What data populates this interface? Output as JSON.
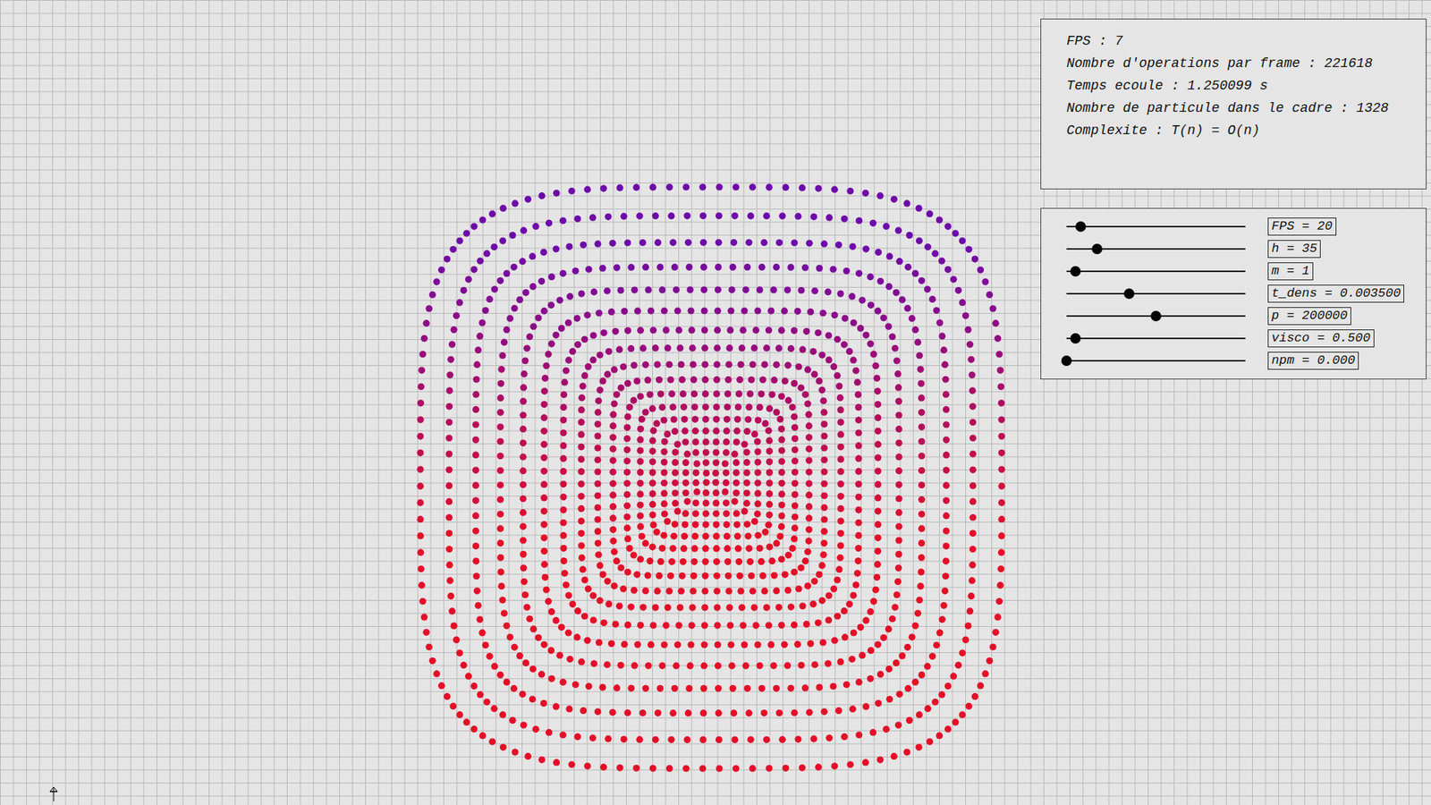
{
  "info": {
    "lines": [
      "FPS : 7",
      "Nombre d'operations par frame : 221618",
      "Temps ecoule : 1.250099 s",
      "Nombre de particule dans le cadre : 1328",
      "Complexite : T(n) = O(n)"
    ]
  },
  "sliders": [
    {
      "label": "FPS = 20",
      "level": 0.08
    },
    {
      "label": "h = 35",
      "level": 0.17
    },
    {
      "label": "m = 1",
      "level": 0.05
    },
    {
      "label": "t_dens = 0.003500",
      "level": 0.35
    },
    {
      "label": "p = 200000",
      "level": 0.5
    },
    {
      "label": "visco = 0.500",
      "level": 0.05
    },
    {
      "label": "npm = 0.000",
      "level": 0.0
    }
  ]
}
